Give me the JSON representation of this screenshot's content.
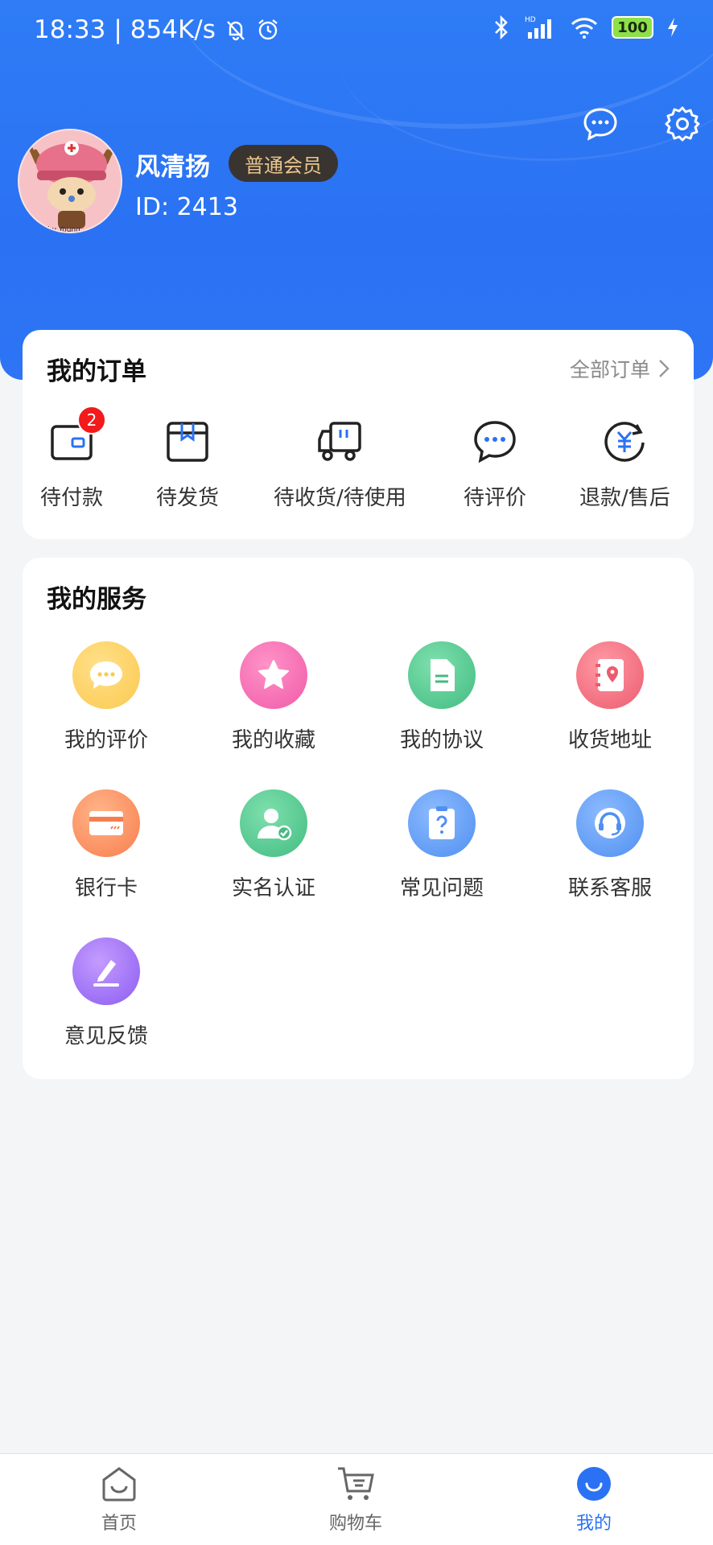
{
  "status_bar": {
    "time": "18:33",
    "separator": "|",
    "net_speed": "854K/s",
    "battery": "100"
  },
  "profile": {
    "username": "风清扬",
    "member_level": "普通会员",
    "user_id": "ID: 2413",
    "avatar_caption": "esign by Young"
  },
  "orders": {
    "title": "我的订单",
    "all_label": "全部订单",
    "items": [
      {
        "label": "待付款",
        "icon": "wallet-icon",
        "badge": "2"
      },
      {
        "label": "待发货",
        "icon": "package-icon"
      },
      {
        "label": "待收货/待使用",
        "icon": "truck-icon"
      },
      {
        "label": "待评价",
        "icon": "comment-icon"
      },
      {
        "label": "退款/售后",
        "icon": "refund-icon"
      }
    ]
  },
  "services": {
    "title": "我的服务",
    "items": [
      {
        "label": "我的评价",
        "icon": "chat-bubble-icon",
        "color": "#fbc94f"
      },
      {
        "label": "我的收藏",
        "icon": "star-icon",
        "color": "#f46ab0"
      },
      {
        "label": "我的协议",
        "icon": "document-icon",
        "color": "#4cc38a"
      },
      {
        "label": "收货地址",
        "icon": "address-book-icon",
        "color": "#f26d7d"
      },
      {
        "label": "银行卡",
        "icon": "bank-card-icon",
        "color": "#fb8a55"
      },
      {
        "label": "实名认证",
        "icon": "verified-user-icon",
        "color": "#4cc38a"
      },
      {
        "label": "常见问题",
        "icon": "question-clipboard-icon",
        "color": "#5b9bf5"
      },
      {
        "label": "联系客服",
        "icon": "headset-icon",
        "color": "#5b9bf5"
      },
      {
        "label": "意见反馈",
        "icon": "edit-pen-icon",
        "color": "#9a6cf0"
      }
    ]
  },
  "tabbar": {
    "items": [
      {
        "label": "首页",
        "icon": "home-icon"
      },
      {
        "label": "购物车",
        "icon": "cart-icon"
      },
      {
        "label": "我的",
        "icon": "profile-smile-icon",
        "active": true
      }
    ]
  },
  "colors": {
    "primary": "#2a72f3",
    "badge_red": "#f21a1a",
    "member_badge_bg": "#3a3430",
    "member_badge_text": "#e9c68e"
  }
}
